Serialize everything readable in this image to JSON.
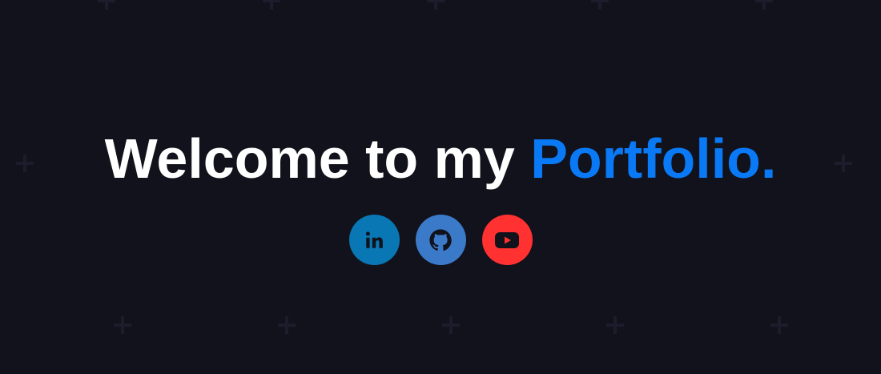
{
  "hero": {
    "headline_main": "Welcome to my ",
    "headline_accent": "Portfolio."
  },
  "socials": [
    {
      "name": "LinkedIn",
      "icon": "linkedin-icon",
      "color": "#0a77b5"
    },
    {
      "name": "GitHub",
      "icon": "github-icon",
      "color": "#3b7ac9"
    },
    {
      "name": "YouTube",
      "icon": "youtube-icon",
      "color": "#ff3131"
    }
  ],
  "theme": {
    "background": "#11121b",
    "text": "#ffffff",
    "accent": "#0a79f5"
  }
}
